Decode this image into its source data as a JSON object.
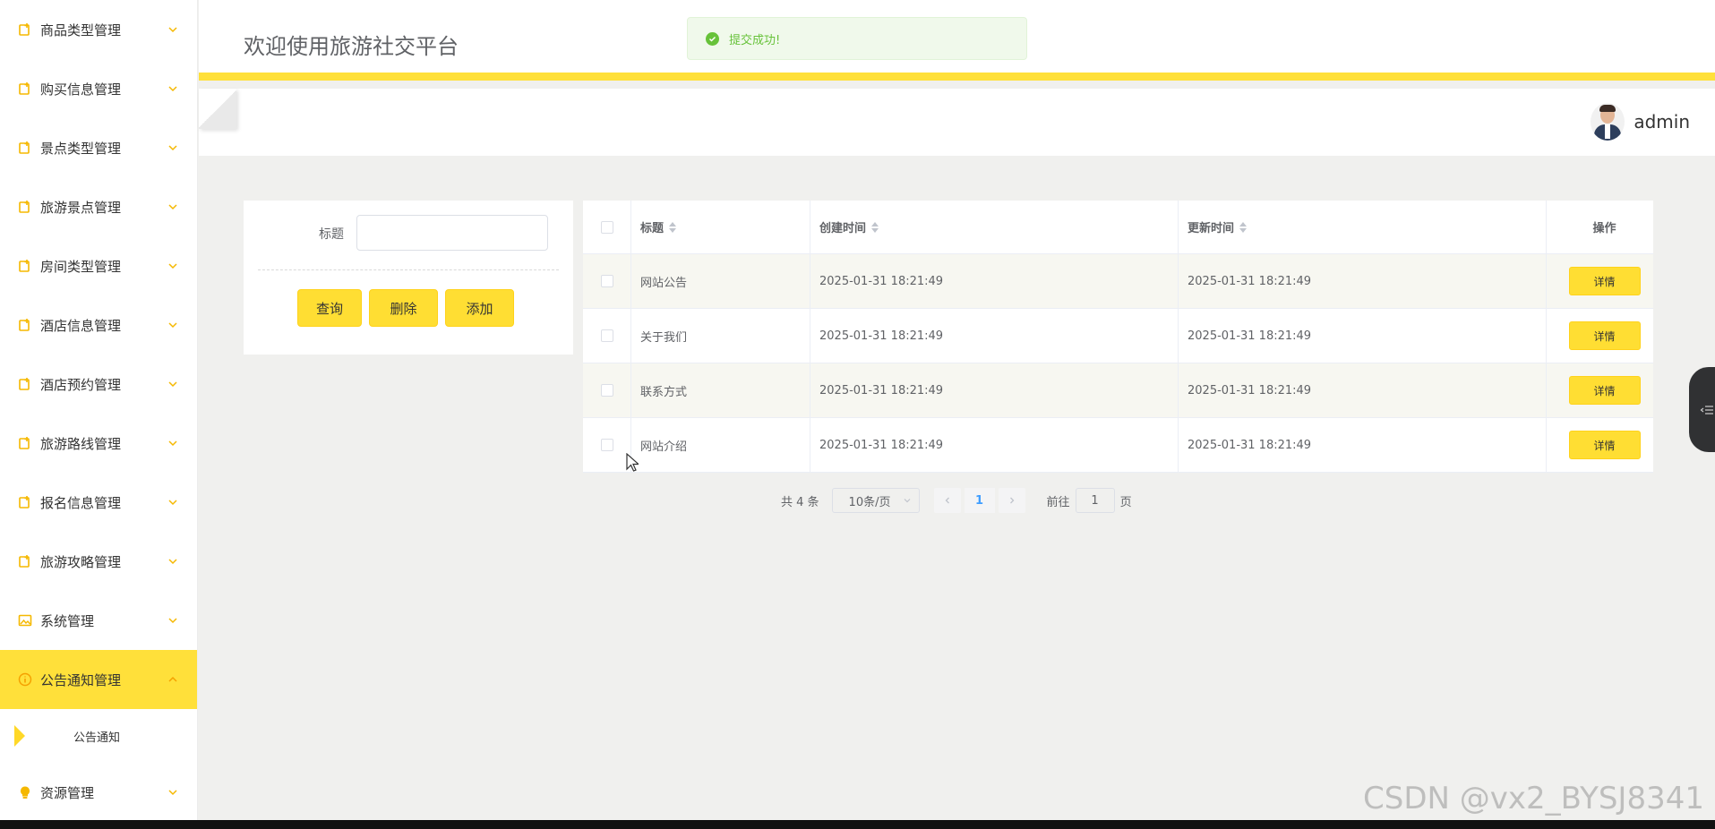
{
  "sidebar": {
    "items": [
      {
        "label": "商品类型管理",
        "icon": "document-add-icon"
      },
      {
        "label": "购买信息管理",
        "icon": "document-add-icon"
      },
      {
        "label": "景点类型管理",
        "icon": "document-add-icon"
      },
      {
        "label": "旅游景点管理",
        "icon": "document-add-icon"
      },
      {
        "label": "房间类型管理",
        "icon": "document-add-icon"
      },
      {
        "label": "酒店信息管理",
        "icon": "document-add-icon"
      },
      {
        "label": "酒店预约管理",
        "icon": "document-add-icon"
      },
      {
        "label": "旅游路线管理",
        "icon": "document-add-icon"
      },
      {
        "label": "报名信息管理",
        "icon": "document-add-icon"
      },
      {
        "label": "旅游攻略管理",
        "icon": "document-add-icon"
      },
      {
        "label": "系统管理",
        "icon": "picture-icon"
      },
      {
        "label": "公告通知管理",
        "icon": "info-icon",
        "active": true
      },
      {
        "label": "资源管理",
        "icon": "lightbulb-icon"
      }
    ],
    "sub_item": "公告通知",
    "accent": "#ffe03a"
  },
  "header": {
    "title": "欢迎使用旅游社交平台",
    "toast": "提交成功!",
    "username": "admin"
  },
  "search": {
    "title_label": "标题",
    "title_value": "",
    "query_label": "查询",
    "delete_label": "删除",
    "add_label": "添加"
  },
  "table": {
    "columns": [
      "标题",
      "创建时间",
      "更新时间",
      "操作"
    ],
    "rows": [
      {
        "title": "网站公告",
        "created": "2025-01-31 18:21:49",
        "updated": "2025-01-31 18:21:49",
        "action": "详情"
      },
      {
        "title": "关于我们",
        "created": "2025-01-31 18:21:49",
        "updated": "2025-01-31 18:21:49",
        "action": "详情"
      },
      {
        "title": "联系方式",
        "created": "2025-01-31 18:21:49",
        "updated": "2025-01-31 18:21:49",
        "action": "详情"
      },
      {
        "title": "网站介绍",
        "created": "2025-01-31 18:21:49",
        "updated": "2025-01-31 18:21:49",
        "action": "详情"
      }
    ]
  },
  "pagination": {
    "total": "共 4 条",
    "page_size": "10条/页",
    "current": "1",
    "goto_prefix": "前往",
    "goto_value": "1",
    "goto_suffix": "页"
  },
  "watermark": "CSDN @vx2_BYSJ8341"
}
